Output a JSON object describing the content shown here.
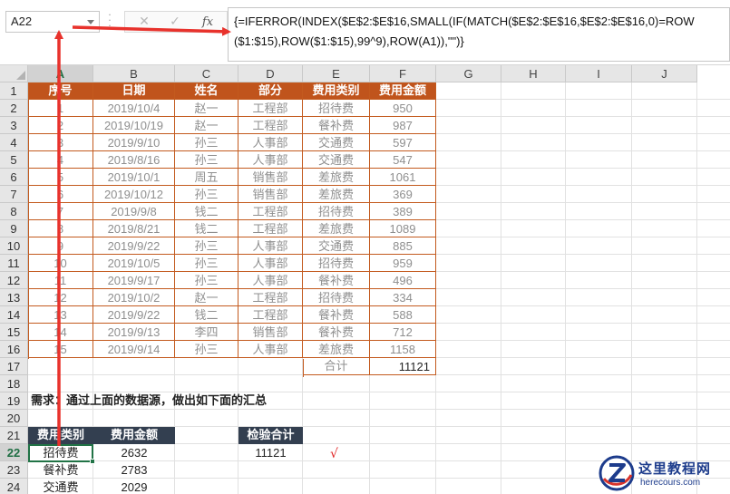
{
  "formula_bar": {
    "name_box": "A22",
    "cancel_icon": "✕",
    "confirm_icon": "✓",
    "fx_label": "fx",
    "formula": "{=IFERROR(INDEX($E$2:$E$16,SMALL(IF(MATCH($E$2:$E$16,$E$2:$E$16,0)=ROW($1:$15),ROW($1:$15),99^9),ROW(A1)),\"\")}"
  },
  "columns": [
    "A",
    "B",
    "C",
    "D",
    "E",
    "F",
    "G",
    "H",
    "I",
    "J"
  ],
  "rows": [
    "1",
    "2",
    "3",
    "4",
    "5",
    "6",
    "7",
    "8",
    "9",
    "10",
    "11",
    "12",
    "13",
    "14",
    "15",
    "16",
    "17",
    "18",
    "19",
    "20",
    "21",
    "22",
    "23",
    "24"
  ],
  "active_cell": {
    "row": "22",
    "col": "A"
  },
  "table": {
    "headers": [
      "序号",
      "日期",
      "姓名",
      "部分",
      "费用类别",
      "费用金额"
    ],
    "rows": [
      [
        "1",
        "2019/10/4",
        "赵一",
        "工程部",
        "招待费",
        "950"
      ],
      [
        "2",
        "2019/10/19",
        "赵一",
        "工程部",
        "餐补费",
        "987"
      ],
      [
        "3",
        "2019/9/10",
        "孙三",
        "人事部",
        "交通费",
        "597"
      ],
      [
        "4",
        "2019/8/16",
        "孙三",
        "人事部",
        "交通费",
        "547"
      ],
      [
        "5",
        "2019/10/1",
        "周五",
        "销售部",
        "差旅费",
        "1061"
      ],
      [
        "6",
        "2019/10/12",
        "孙三",
        "销售部",
        "差旅费",
        "369"
      ],
      [
        "7",
        "2019/9/8",
        "钱二",
        "工程部",
        "招待费",
        "389"
      ],
      [
        "8",
        "2019/8/21",
        "钱二",
        "工程部",
        "差旅费",
        "1089"
      ],
      [
        "9",
        "2019/9/22",
        "孙三",
        "人事部",
        "交通费",
        "885"
      ],
      [
        "10",
        "2019/10/5",
        "孙三",
        "人事部",
        "招待费",
        "959"
      ],
      [
        "11",
        "2019/9/17",
        "孙三",
        "人事部",
        "餐补费",
        "496"
      ],
      [
        "12",
        "2019/10/2",
        "赵一",
        "工程部",
        "招待费",
        "334"
      ],
      [
        "13",
        "2019/9/22",
        "钱二",
        "工程部",
        "餐补费",
        "588"
      ],
      [
        "14",
        "2019/9/13",
        "李四",
        "销售部",
        "餐补费",
        "712"
      ],
      [
        "15",
        "2019/9/14",
        "孙三",
        "人事部",
        "差旅费",
        "1158"
      ]
    ],
    "total_label": "合计",
    "total_value": "11121"
  },
  "requirement_text": "需求：通过上面的数据源，做出如下面的汇总",
  "summary": {
    "headers": [
      "费用类别",
      "费用金额"
    ],
    "rows": [
      [
        "招待费",
        "2632"
      ],
      [
        "餐补费",
        "2783"
      ],
      [
        "交通费",
        "2029"
      ]
    ]
  },
  "check": {
    "header": "检验合计",
    "value": "11121",
    "mark": "√"
  },
  "watermark": {
    "title": "这里教程网",
    "url": "herecours.com"
  },
  "colors": {
    "table_header": "#c0541c",
    "table_border": "#c35a1e",
    "summary_header": "#333f50",
    "annotation_arrow": "#e8322c",
    "selection": "#217346"
  }
}
